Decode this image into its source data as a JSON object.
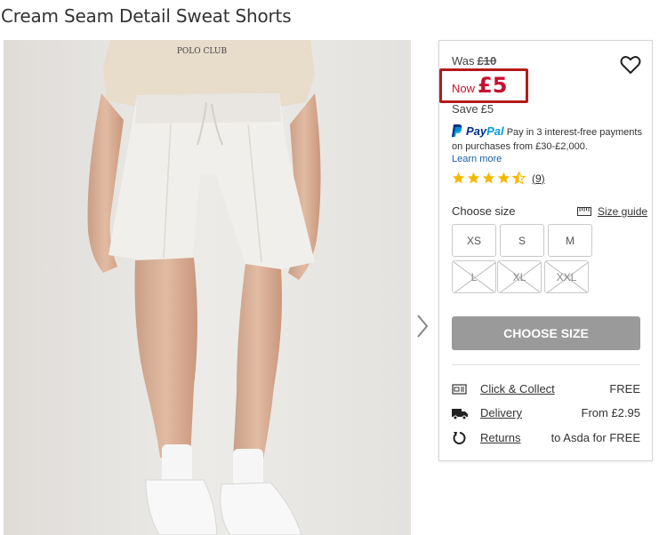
{
  "product": {
    "title": "Cream Seam Detail Sweat Shorts"
  },
  "image": {
    "logo_text": "POLO CLUB"
  },
  "pricing": {
    "was_label": "Was",
    "was_price": "£10",
    "now_label": "Now",
    "now_price": "£5",
    "save_label": "Save",
    "save_amount": "£5",
    "accent_color": "#c8102e"
  },
  "paypal": {
    "brand_a": "Pay",
    "brand_b": "Pal",
    "line1": "Pay in 3 interest-free payments",
    "line2": "on purchases from £30-£2,000.",
    "learn_more": "Learn more"
  },
  "rating": {
    "stars": 4.5,
    "out_of": 5,
    "count": "(9)",
    "star_color": "#f5b800"
  },
  "size_select": {
    "label": "Choose size",
    "guide_label": "Size guide",
    "options": [
      {
        "label": "XS",
        "available": true
      },
      {
        "label": "S",
        "available": true
      },
      {
        "label": "M",
        "available": true
      },
      {
        "label": "L",
        "available": false
      },
      {
        "label": "XL",
        "available": false
      },
      {
        "label": "XXL",
        "available": false
      }
    ]
  },
  "cta": {
    "label": "CHOOSE SIZE"
  },
  "delivery": [
    {
      "icon": "store-icon",
      "label": "Click & Collect",
      "value": "FREE"
    },
    {
      "icon": "truck-icon",
      "label": "Delivery",
      "value": "From £2.95"
    },
    {
      "icon": "returns-icon",
      "label": "Returns",
      "value": "to Asda for FREE"
    }
  ]
}
